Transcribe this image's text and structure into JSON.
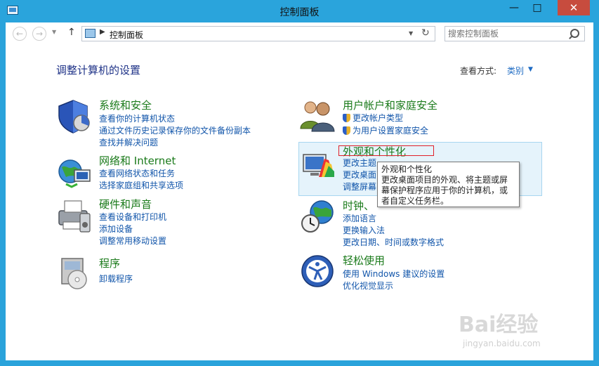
{
  "window": {
    "title": "控制面板"
  },
  "titlebar_buttons": {
    "minimize": "—",
    "maximize": "□",
    "close": "✕"
  },
  "nav": {
    "back": "←",
    "forward": "→",
    "up": "↑",
    "breadcrumb": "控制面板",
    "search_placeholder": "搜索控制面板"
  },
  "main": {
    "title": "调整计算机的设置",
    "view_label": "查看方式:",
    "view_value": "类别"
  },
  "categories": {
    "system": {
      "title": "系统和安全",
      "links": [
        "查看你的计算机状态",
        "通过文件历史记录保存你的文件备份副本",
        "查找并解决问题"
      ]
    },
    "network": {
      "title": "网络和 Internet",
      "links": [
        "查看网络状态和任务",
        "选择家庭组和共享选项"
      ]
    },
    "hardware": {
      "title": "硬件和声音",
      "links": [
        "查看设备和打印机",
        "添加设备",
        "调整常用移动设置"
      ]
    },
    "programs": {
      "title": "程序",
      "links": [
        "卸载程序"
      ]
    },
    "users": {
      "title": "用户帐户和家庭安全",
      "links": [
        "更改帐户类型",
        "为用户设置家庭安全"
      ]
    },
    "appearance": {
      "title": "外观和个性化",
      "links": [
        "更改主题",
        "更改桌面",
        "调整屏幕"
      ]
    },
    "clock": {
      "title": "时钟、",
      "links": [
        "添加语言",
        "更换输入法",
        "更改日期、时间或数字格式"
      ]
    },
    "ease": {
      "title": "轻松使用",
      "links": [
        "使用 Windows 建议的设置",
        "优化视觉显示"
      ]
    }
  },
  "tooltip": {
    "title": "外观和个性化",
    "body": "更改桌面项目的外观、将主题或屏幕保护程序应用于你的计算机，或者自定义任务栏。"
  },
  "watermark": {
    "brand": "Bai经验",
    "url": "jingyan.baidu.com"
  }
}
